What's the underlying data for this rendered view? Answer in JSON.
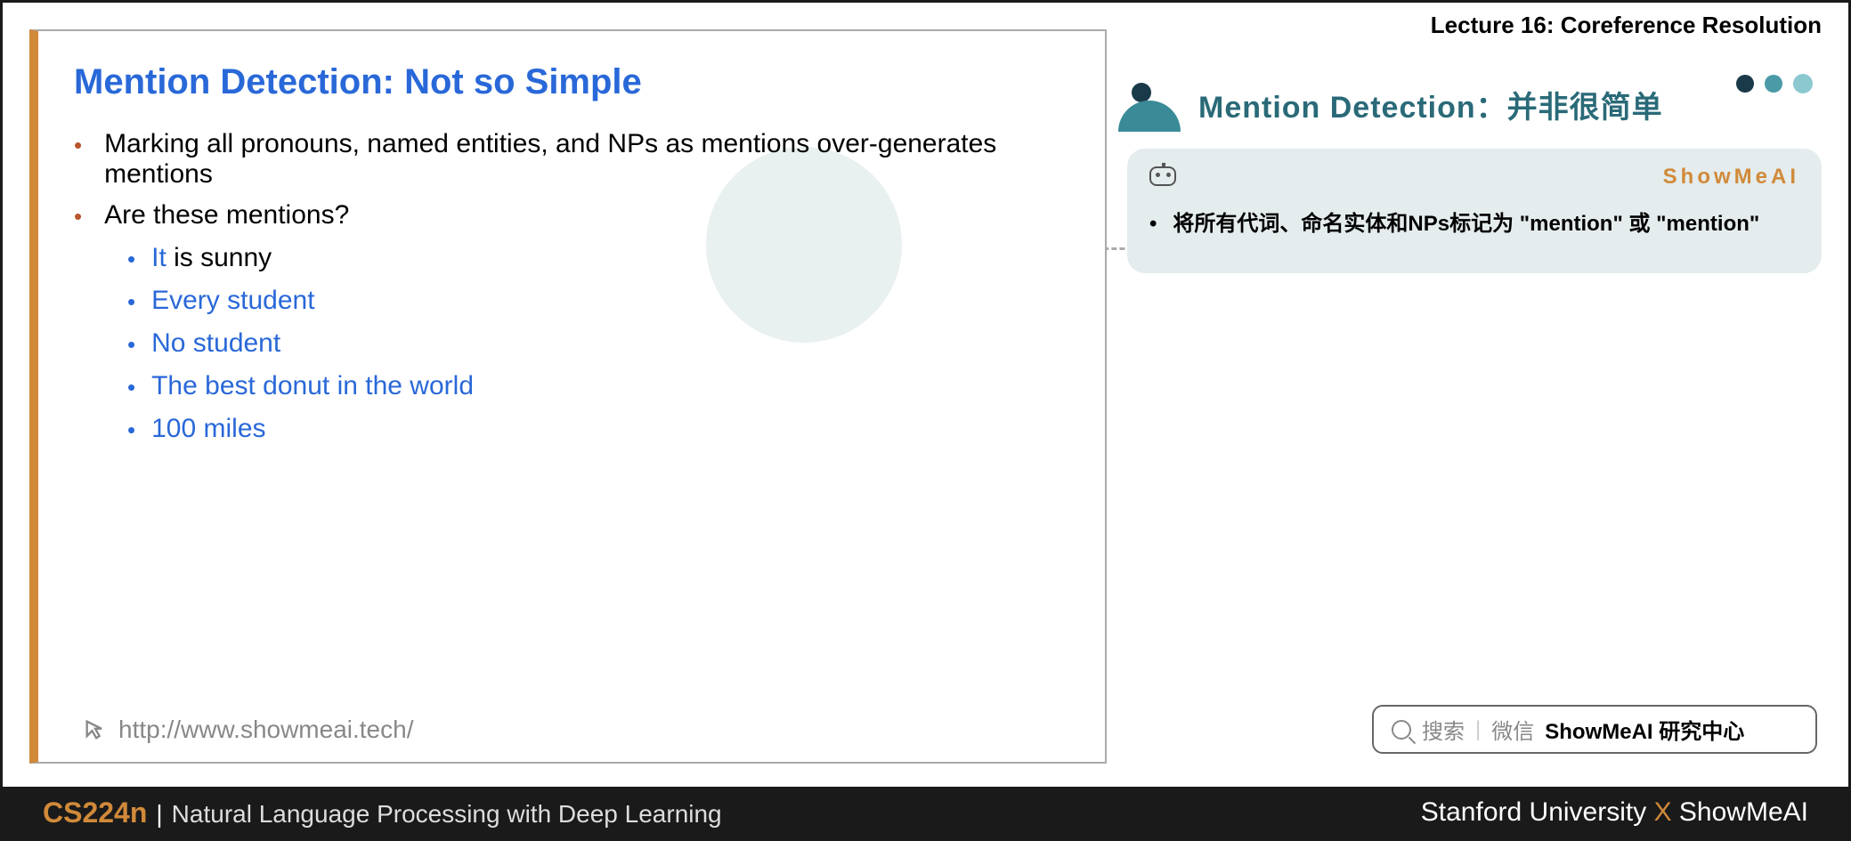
{
  "header": {
    "lecture_title": "Lecture 16: Coreference Resolution"
  },
  "slide": {
    "title": "Mention Detection: Not so Simple",
    "bullets": [
      {
        "text": "Marking all pronouns, named entities, and NPs as mentions over-generates mentions"
      },
      {
        "text": "Are these mentions?"
      }
    ],
    "sub_bullets": [
      {
        "highlighted": "It",
        "rest": " is sunny"
      },
      {
        "text": "Every student"
      },
      {
        "text": "No student"
      },
      {
        "text": "The best donut in the world"
      },
      {
        "text": "100 miles"
      }
    ],
    "url": "http://www.showmeai.tech/"
  },
  "sidebar": {
    "title": "Mention Detection：并非很简单",
    "brand": "ShowMeAI",
    "note_text": "将所有代词、命名实体和NPs标记为 \"mention\" 或 \"mention\""
  },
  "search": {
    "label1": "搜索",
    "label2": "微信",
    "bold_text": "ShowMeAI 研究中心"
  },
  "footer": {
    "course_code": "CS224n",
    "separator": "|",
    "course_name": "Natural Language Processing with Deep Learning",
    "university": "Stanford University",
    "x": "X",
    "org": "ShowMeAI"
  }
}
